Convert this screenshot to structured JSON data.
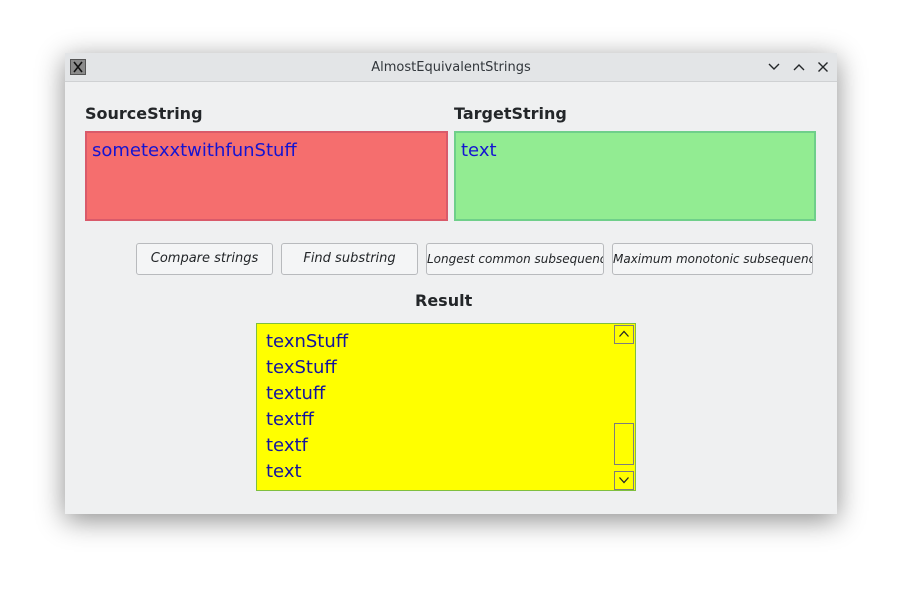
{
  "window": {
    "title": "AlmostEquivalentStrings",
    "icon": "x11-app-icon",
    "controls": [
      "minimize-icon",
      "maximize-icon",
      "close-icon"
    ]
  },
  "source": {
    "label": "SourceString",
    "value": "sometexxtwithfunStuff",
    "background": "#f56e6e"
  },
  "target": {
    "label": "TargetString",
    "value": "text",
    "background": "#92ec92"
  },
  "buttons": {
    "compare": "Compare strings",
    "find": "Find substring",
    "lcs": "Longest common subsequence",
    "mms": "Maximum monotonic subsequence"
  },
  "result": {
    "label": "Result",
    "background": "#ffff00",
    "items": [
      "texnStuff",
      "texStuff",
      "textuff",
      "textff",
      "textf",
      "text"
    ]
  }
}
